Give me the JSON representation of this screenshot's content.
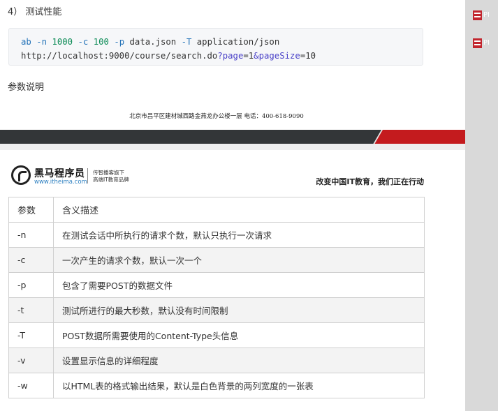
{
  "doc": {
    "section_heading": "4） 测试性能",
    "code": {
      "line1": [
        {
          "t": "ab",
          "c": "kw"
        },
        {
          "t": " ",
          "c": ""
        },
        {
          "t": "-n",
          "c": "kw"
        },
        {
          "t": " ",
          "c": ""
        },
        {
          "t": "1000",
          "c": "num"
        },
        {
          "t": " ",
          "c": ""
        },
        {
          "t": "-c",
          "c": "kw"
        },
        {
          "t": " ",
          "c": ""
        },
        {
          "t": "100",
          "c": "num"
        },
        {
          "t": " ",
          "c": ""
        },
        {
          "t": "-p",
          "c": "kw"
        },
        {
          "t": " data.json ",
          "c": ""
        },
        {
          "t": "-T",
          "c": "kw"
        },
        {
          "t": " application/json",
          "c": ""
        }
      ],
      "line2": [
        {
          "t": "http://localhost:9000/course/search.do",
          "c": ""
        },
        {
          "t": "?page",
          "c": "par"
        },
        {
          "t": "=1",
          "c": ""
        },
        {
          "t": "&pageSize",
          "c": "par"
        },
        {
          "t": "=10",
          "c": ""
        }
      ]
    },
    "params_heading": "参数说明",
    "footer_address": "北京市昌平区建材城西路金燕龙办公楼一层   电话：400-618-9090"
  },
  "header": {
    "brand": "黑马程序员",
    "url": "www.itheima.com",
    "tagline1": "传智播客旗下",
    "tagline2": "高端IT教育品牌",
    "slogan": "改变中国IT教育，我们正在行动"
  },
  "table": {
    "headers": [
      "参数",
      "含义描述"
    ],
    "rows": [
      [
        "-n",
        "在测试会话中所执行的请求个数，默认只执行一次请求"
      ],
      [
        "-c",
        "一次产生的请求个数，默认一次一个"
      ],
      [
        "-p",
        "包含了需要POST的数据文件"
      ],
      [
        "-t",
        "测试所进行的最大秒数，默认没有时间限制"
      ],
      [
        "-T",
        "POST数据所需要使用的Content-Type头信息"
      ],
      [
        "-v",
        "设置显示信息的详细程度"
      ],
      [
        "-w",
        "以HTML表的格式输出结果，默认是白色背景的两列宽度的一张表"
      ]
    ]
  },
  "sidebar": {
    "items": [
      {
        "label": "PI",
        "icon": "pdf-icon"
      },
      {
        "label": "PI",
        "icon": "pdf-icon"
      }
    ]
  },
  "colors": {
    "keyword": "#2473b8",
    "number": "#0b8b55",
    "param": "#4a41c8",
    "band_dark": "#333638",
    "band_red": "#c41b1e",
    "sidebar_bg": "#d9d9d9"
  }
}
